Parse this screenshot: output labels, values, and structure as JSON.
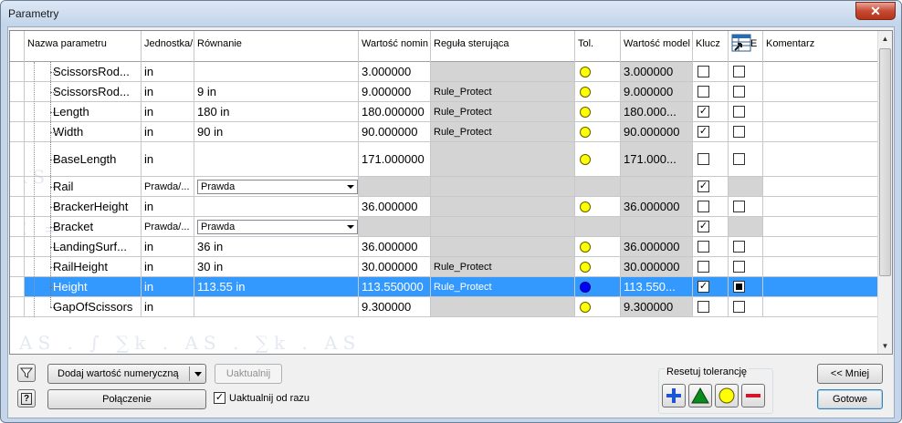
{
  "window": {
    "title": "Parametry",
    "close_glyph": "✕"
  },
  "columns": {
    "name": "Nazwa parametru",
    "unit": "Jednostka/",
    "equation": "Równanie",
    "nominal": "Wartość nomin",
    "rule": "Reguła sterująca",
    "tol": "Tol.",
    "model": "Wartość model",
    "key": "Klucz",
    "export": "E",
    "comment": "Komentarz"
  },
  "rows": [
    {
      "name": "ScissorsRod...",
      "unit": "in",
      "equation": "",
      "nominal": "3.000000",
      "rule": "",
      "tol": "yellow",
      "model": "3.000000",
      "key": false,
      "export": false,
      "gray_eq": false
    },
    {
      "name": "ScissorsRod...",
      "unit": "in",
      "equation": "9 in",
      "nominal": "9.000000",
      "rule": "Rule_Protect",
      "tol": "yellow",
      "model": "9.000000",
      "key": false,
      "export": false
    },
    {
      "name": "Length",
      "unit": "in",
      "equation": "180 in",
      "nominal": "180.000000",
      "rule": "Rule_Protect",
      "tol": "yellow",
      "model": "180.000...",
      "key": true,
      "export": false
    },
    {
      "name": "Width",
      "unit": "in",
      "equation": "90 in",
      "nominal": "90.000000",
      "rule": "Rule_Protect",
      "tol": "yellow",
      "model": "90.000000",
      "key": true,
      "export": false
    },
    {
      "name": "BaseLength",
      "unit": "in",
      "equation": "",
      "nominal": "171.000000",
      "rule": "",
      "tol": "yellow",
      "model": "171.000...",
      "key": false,
      "export": false
    },
    {
      "name": "Rail",
      "unit": "Prawda/...",
      "equation_combo": "Prawda",
      "nominal": "",
      "rule": "",
      "tol": "",
      "model": "",
      "key": true,
      "export": null
    },
    {
      "name": "BrackerHeight",
      "unit": "in",
      "equation": "",
      "nominal": "36.000000",
      "rule": "",
      "tol": "yellow",
      "model": "36.000000",
      "key": false,
      "export": false
    },
    {
      "name": "Bracket",
      "unit": "Prawda/...",
      "equation_combo": "Prawda",
      "nominal": "",
      "rule": "",
      "tol": "",
      "model": "",
      "key": true,
      "export": null
    },
    {
      "name": "LandingSurf...",
      "unit": "in",
      "equation": "36 in",
      "nominal": "36.000000",
      "rule": "",
      "tol": "yellow",
      "model": "36.000000",
      "key": false,
      "export": false
    },
    {
      "name": "RailHeight",
      "unit": "in",
      "equation": "30 in",
      "nominal": "30.000000",
      "rule": "Rule_Protect",
      "tol": "yellow",
      "model": "30.000000",
      "key": false,
      "export": false
    },
    {
      "name": "Height",
      "unit": "in",
      "equation": "113.55 in",
      "nominal": "113.550000",
      "rule": "Rule_Protect",
      "tol": "blue",
      "model": "113.550...",
      "key": true,
      "export": true,
      "selected": true
    },
    {
      "name": "GapOfScissors",
      "unit": "in",
      "equation": "",
      "nominal": "9.300000",
      "rule": "",
      "tol": "yellow",
      "model": "9.300000",
      "key": false,
      "export": false
    }
  ],
  "bottom": {
    "add_numeric": "Dodaj wartość numeryczną",
    "update": "Uaktualnij",
    "link": "Połączenie",
    "update_immediately": "Uaktualnij od razu",
    "update_immediately_checked": true,
    "reset_tolerance": "Resetuj tolerancję",
    "less": "<< Mniej",
    "done": "Gotowe"
  }
}
